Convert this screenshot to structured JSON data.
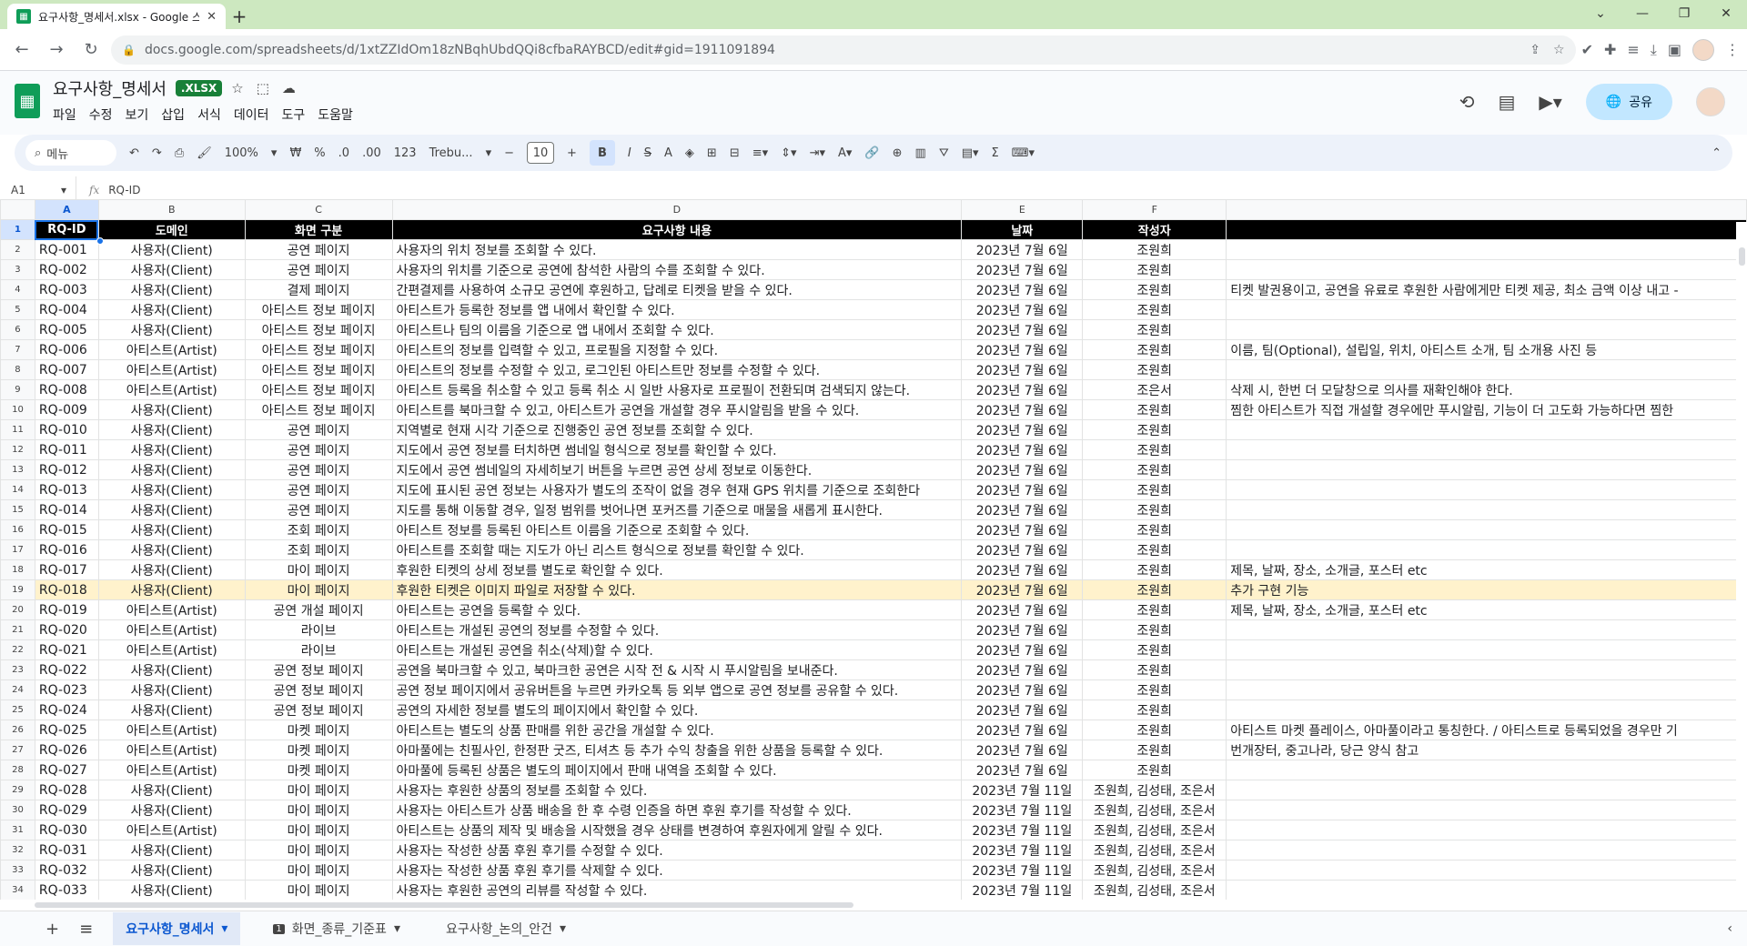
{
  "browser": {
    "tab_title": "요구사항_명세서.xlsx - Google 스...",
    "url": "docs.google.com/spreadsheets/d/1xtZZIdOm18zNBqhUbdQQi8cfbaRAYBCD/edit#gid=1911091894"
  },
  "doc": {
    "name": "요구사항_명세서",
    "badge": ".XLSX",
    "menus": [
      "파일",
      "수정",
      "보기",
      "삽입",
      "서식",
      "데이터",
      "도구",
      "도움말"
    ],
    "share_label": "공유"
  },
  "toolbar": {
    "search_label": "메뉴",
    "zoom": "100%",
    "currency": "₩",
    "percent": "%",
    "dec_minus": ".0",
    "dec_plus": ".00",
    "numfmt": "123",
    "font": "Trebu...",
    "font_size": "10",
    "bold": "B",
    "italic": "I",
    "strike": "S",
    "textcolor": "A"
  },
  "formula_bar": {
    "name_box": "A1",
    "fx": "fx",
    "value": "RQ-ID"
  },
  "columns": [
    "A",
    "B",
    "C",
    "D",
    "E",
    "F",
    ""
  ],
  "header": [
    "RQ-ID",
    "도메인",
    "화면 구분",
    "요구사항 내용",
    "날짜",
    "작성자",
    ""
  ],
  "rows": [
    [
      "RQ-001",
      "사용자(Client)",
      "공연 페이지",
      "사용자의 위치 정보를 조회할 수 있다.",
      "2023년 7월 6일",
      "조원희",
      ""
    ],
    [
      "RQ-002",
      "사용자(Client)",
      "공연 페이지",
      "사용자의 위치를 기준으로 공연에 참석한 사람의 수를 조회할 수 있다.",
      "2023년 7월 6일",
      "조원희",
      ""
    ],
    [
      "RQ-003",
      "사용자(Client)",
      "결제 페이지",
      "간편결제를 사용하여 소규모 공연에 후원하고, 답례로 티켓을 받을 수 있다.",
      "2023년 7월 6일",
      "조원희",
      "티켓 발권용이고, 공연을 유료로 후원한 사람에게만 티켓 제공, 최소 금액 이상 내고 -"
    ],
    [
      "RQ-004",
      "사용자(Client)",
      "아티스트 정보 페이지",
      "아티스트가 등록한 정보를 앱 내에서 확인할 수 있다.",
      "2023년 7월 6일",
      "조원희",
      ""
    ],
    [
      "RQ-005",
      "사용자(Client)",
      "아티스트 정보 페이지",
      "아티스트나 팀의 이름을 기준으로 앱 내에서 조회할 수 있다.",
      "2023년 7월 6일",
      "조원희",
      ""
    ],
    [
      "RQ-006",
      "아티스트(Artist)",
      "아티스트 정보 페이지",
      "아티스트의 정보를 입력할 수 있고, 프로필을 지정할 수 있다.",
      "2023년 7월 6일",
      "조원희",
      "이름, 팀(Optional), 설립일, 위치, 아티스트 소개, 팀 소개용 사진 등"
    ],
    [
      "RQ-007",
      "아티스트(Artist)",
      "아티스트 정보 페이지",
      "아티스트의 정보를 수정할 수 있고, 로그인된 아티스트만 정보를 수정할 수 있다.",
      "2023년 7월 6일",
      "조원희",
      ""
    ],
    [
      "RQ-008",
      "아티스트(Artist)",
      "아티스트 정보 페이지",
      "아티스트 등록을 취소할 수 있고 등록 취소 시 일반 사용자로 프로필이 전환되며 검색되지 않는다.",
      "2023년 7월 6일",
      "조은서",
      "삭제 시, 한번 더 모달창으로 의사를 재확인해야 한다."
    ],
    [
      "RQ-009",
      "사용자(Client)",
      "아티스트 정보 페이지",
      "아티스트를 북마크할 수 있고, 아티스트가 공연을 개설할 경우 푸시알림을 받을 수 있다.",
      "2023년 7월 6일",
      "조원희",
      "찜한 아티스트가 직접 개설할 경우에만 푸시알림, 기능이 더 고도화 가능하다면 찜한"
    ],
    [
      "RQ-010",
      "사용자(Client)",
      "공연 페이지",
      "지역별로 현재 시각 기준으로 진행중인 공연 정보를 조회할 수 있다.",
      "2023년 7월 6일",
      "조원희",
      ""
    ],
    [
      "RQ-011",
      "사용자(Client)",
      "공연 페이지",
      "지도에서 공연 정보를 터치하면 썸네일 형식으로 정보를 확인할 수 있다.",
      "2023년 7월 6일",
      "조원희",
      ""
    ],
    [
      "RQ-012",
      "사용자(Client)",
      "공연 페이지",
      "지도에서 공연 썸네일의 자세히보기 버튼을 누르면 공연 상세 정보로 이동한다.",
      "2023년 7월 6일",
      "조원희",
      ""
    ],
    [
      "RQ-013",
      "사용자(Client)",
      "공연 페이지",
      "지도에 표시된 공연 정보는 사용자가 별도의 조작이 없을 경우 현재 GPS 위치를 기준으로 조회한다",
      "2023년 7월 6일",
      "조원희",
      ""
    ],
    [
      "RQ-014",
      "사용자(Client)",
      "공연 페이지",
      "지도를 통해 이동할 경우, 일정 범위를 벗어나면 포커즈를 기준으로 매물을 새롭게 표시한다.",
      "2023년 7월 6일",
      "조원희",
      ""
    ],
    [
      "RQ-015",
      "사용자(Client)",
      "조회 페이지",
      "아티스트 정보를 등록된 아티스트 이름을 기준으로 조회할 수 있다.",
      "2023년 7월 6일",
      "조원희",
      ""
    ],
    [
      "RQ-016",
      "사용자(Client)",
      "조회 페이지",
      "아티스트를 조회할 때는 지도가 아닌 리스트 형식으로 정보를 확인할 수 있다.",
      "2023년 7월 6일",
      "조원희",
      ""
    ],
    [
      "RQ-017",
      "사용자(Client)",
      "마이 페이지",
      "후원한 티켓의 상세 정보를 별도로 확인할 수 있다.",
      "2023년 7월 6일",
      "조원희",
      "제목, 날짜, 장소, 소개글, 포스터 etc"
    ],
    [
      "RQ-018",
      "사용자(Client)",
      "마이 페이지",
      "후원한 티켓은 이미지 파일로 저장할 수 있다.",
      "2023년 7월 6일",
      "조원희",
      "추가 구현 기능"
    ],
    [
      "RQ-019",
      "아티스트(Artist)",
      "공연 개설 페이지",
      "아티스트는 공연을 등록할 수 있다.",
      "2023년 7월 6일",
      "조원희",
      "제목, 날짜, 장소, 소개글, 포스터 etc"
    ],
    [
      "RQ-020",
      "아티스트(Artist)",
      "라이브",
      "아티스트는 개설된 공연의 정보를 수정할 수 있다.",
      "2023년 7월 6일",
      "조원희",
      ""
    ],
    [
      "RQ-021",
      "아티스트(Artist)",
      "라이브",
      "아티스트는 개설된 공연을 취소(삭제)할 수 있다.",
      "2023년 7월 6일",
      "조원희",
      ""
    ],
    [
      "RQ-022",
      "사용자(Client)",
      "공연 정보 페이지",
      "공연을 북마크할 수 있고, 북마크한 공연은 시작 전 & 시작 시 푸시알림을 보내준다.",
      "2023년 7월 6일",
      "조원희",
      ""
    ],
    [
      "RQ-023",
      "사용자(Client)",
      "공연 정보 페이지",
      "공연 정보 페이지에서 공유버튼을 누르면 카카오톡 등 외부 앱으로 공연 정보를 공유할 수 있다.",
      "2023년 7월 6일",
      "조원희",
      ""
    ],
    [
      "RQ-024",
      "사용자(Client)",
      "공연 정보 페이지",
      "공연의 자세한 정보를 별도의 페이지에서 확인할 수 있다.",
      "2023년 7월 6일",
      "조원희",
      ""
    ],
    [
      "RQ-025",
      "아티스트(Artist)",
      "마켓 페이지",
      "아티스트는 별도의 상품 판매를 위한 공간을 개설할 수 있다.",
      "2023년 7월 6일",
      "조원희",
      "아티스트 마켓 플레이스, 아마풀이라고 통칭한다. / 아티스트로 등록되었을 경우만 기"
    ],
    [
      "RQ-026",
      "아티스트(Artist)",
      "마켓 페이지",
      "아마풀에는 친필사인, 한정판 굿즈, 티셔츠 등 추가 수익 창출을 위한 상품을 등록할 수 있다.",
      "2023년 7월 6일",
      "조원희",
      "번개장터, 중고나라, 당근 양식 참고"
    ],
    [
      "RQ-027",
      "아티스트(Artist)",
      "마켓 페이지",
      "아마풀에 등록된 상품은 별도의 페이지에서 판매 내역을 조회할 수 있다.",
      "2023년 7월 6일",
      "조원희",
      ""
    ],
    [
      "RQ-028",
      "사용자(Client)",
      "마이 페이지",
      "사용자는 후원한 상품의 정보를 조회할 수 있다.",
      "2023년 7월 11일",
      "조원희, 김성태, 조은서",
      ""
    ],
    [
      "RQ-029",
      "사용자(Client)",
      "마이 페이지",
      "사용자는 아티스트가 상품 배송을 한 후 수령 인증을 하면 후원 후기를 작성할 수 있다.",
      "2023년 7월 11일",
      "조원희, 김성태, 조은서",
      ""
    ],
    [
      "RQ-030",
      "아티스트(Artist)",
      "마이 페이지",
      "아티스트는 상품의 제작 및 배송을 시작했을 경우 상태를 변경하여 후원자에게 알릴 수 있다.",
      "2023년 7월 11일",
      "조원희, 김성태, 조은서",
      ""
    ],
    [
      "RQ-031",
      "사용자(Client)",
      "마이 페이지",
      "사용자는 작성한 상품 후원 후기를 수정할 수 있다.",
      "2023년 7월 11일",
      "조원희, 김성태, 조은서",
      ""
    ],
    [
      "RQ-032",
      "사용자(Client)",
      "마이 페이지",
      "사용자는 작성한 상품 후원 후기를 삭제할 수 있다.",
      "2023년 7월 11일",
      "조원희, 김성태, 조은서",
      ""
    ],
    [
      "RQ-033",
      "사용자(Client)",
      "마이 페이지",
      "사용자는 후원한 공연의 리뷰를 작성할 수 있다.",
      "2023년 7월 11일",
      "조원희, 김성태, 조은서",
      ""
    ]
  ],
  "highlight_row": 17,
  "sheets": [
    {
      "label": "요구사항_명세서",
      "active": true
    },
    {
      "label": "화면_종류_기준표",
      "num": "1",
      "active": false
    },
    {
      "label": "요구사항_논의_안건",
      "active": false
    }
  ]
}
